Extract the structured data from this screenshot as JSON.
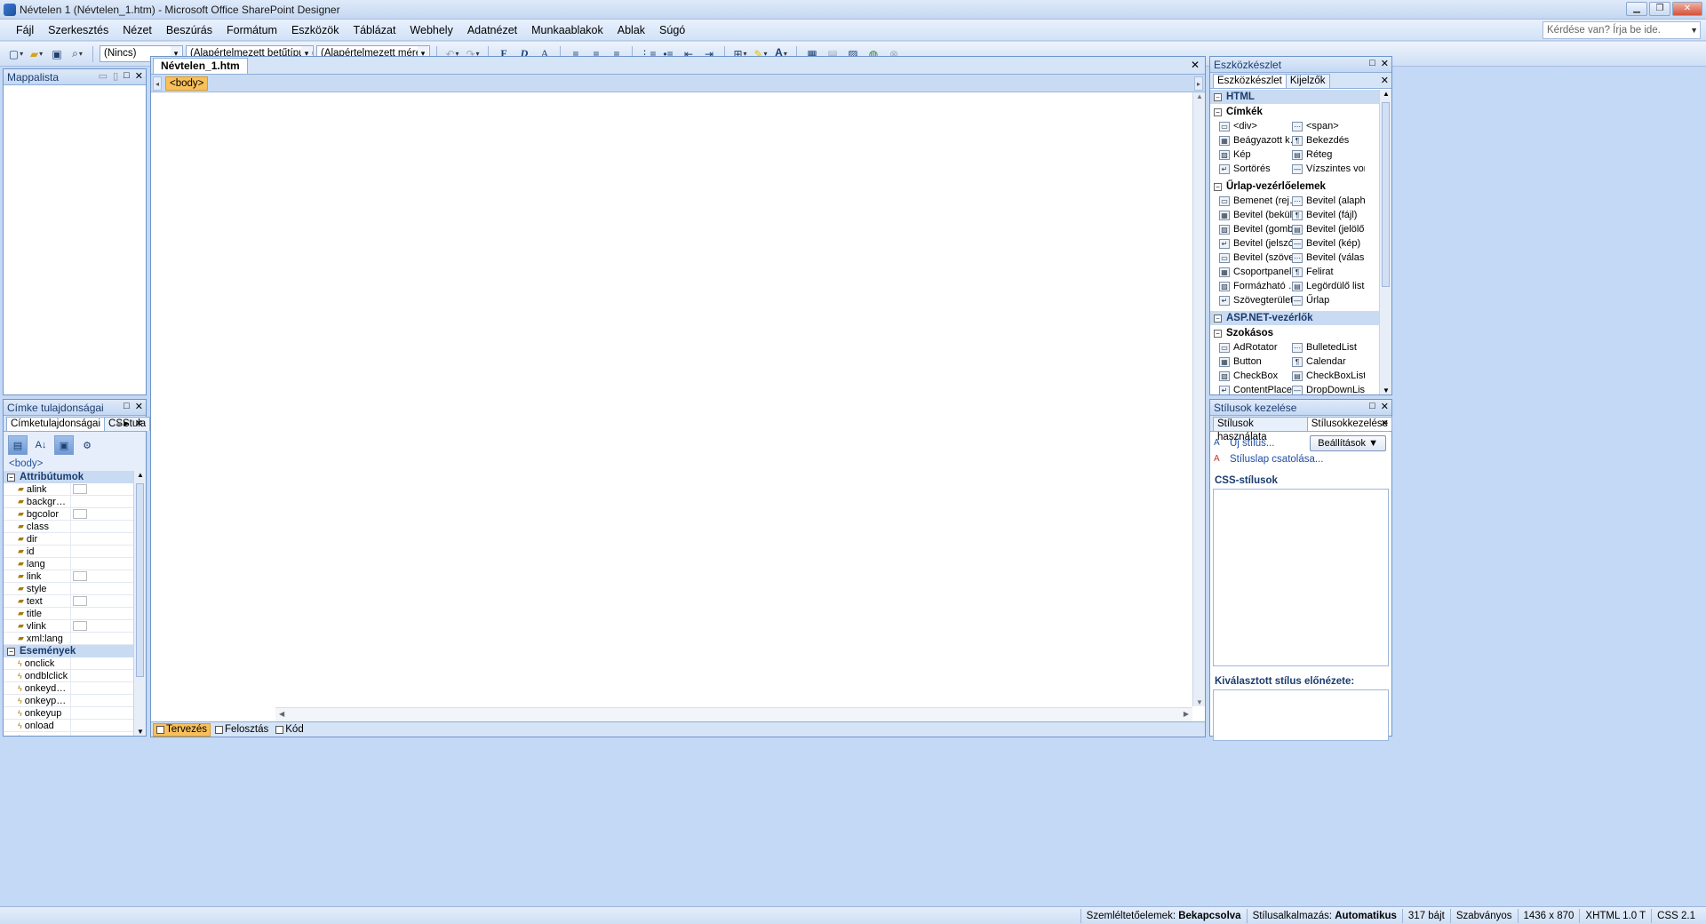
{
  "window": {
    "title": "Névtelen 1 (Névtelen_1.htm) - Microsoft Office SharePoint Designer"
  },
  "menu": {
    "items": [
      "Fájl",
      "Szerkesztés",
      "Nézet",
      "Beszúrás",
      "Formátum",
      "Eszközök",
      "Táblázat",
      "Webhely",
      "Adatnézet",
      "Munkaablakok",
      "Ablak",
      "Súgó"
    ],
    "help_placeholder": "Kérdése van? Írja be ide."
  },
  "toolbar": {
    "style_select": "(Nincs)",
    "font_select": "(Alapértelmezett betűtípus)",
    "size_select": "(Alapértelmezett mére",
    "bold": "F",
    "italic": "D",
    "underline": "A",
    "font_color": "A"
  },
  "folder_list": {
    "title": "Mappalista"
  },
  "tag_properties": {
    "title": "Címke tulajdonságai",
    "tab_tag": "Címketulajdonságai",
    "tab_css": "CSStula",
    "current_tag": "<body>",
    "categories": [
      {
        "name": "Attribútumok",
        "rows": [
          {
            "name": "alink",
            "swatch": true
          },
          {
            "name": "backgr…",
            "swatch": false
          },
          {
            "name": "bgcolor",
            "swatch": true
          },
          {
            "name": "class",
            "swatch": false
          },
          {
            "name": "dir",
            "swatch": false
          },
          {
            "name": "id",
            "swatch": false
          },
          {
            "name": "lang",
            "swatch": false
          },
          {
            "name": "link",
            "swatch": true
          },
          {
            "name": "style",
            "swatch": false
          },
          {
            "name": "text",
            "swatch": true
          },
          {
            "name": "title",
            "swatch": false
          },
          {
            "name": "vlink",
            "swatch": true
          },
          {
            "name": "xml:lang",
            "swatch": false
          }
        ]
      },
      {
        "name": "Események",
        "rows": [
          {
            "name": "onclick",
            "swatch": false
          },
          {
            "name": "ondblclick",
            "swatch": false
          },
          {
            "name": "onkeyd…",
            "swatch": false
          },
          {
            "name": "onkeyp…",
            "swatch": false
          },
          {
            "name": "onkeyup",
            "swatch": false
          },
          {
            "name": "onload",
            "swatch": false
          },
          {
            "name": "onmous…",
            "swatch": false
          }
        ]
      }
    ]
  },
  "editor": {
    "doc_tab": "Névtelen_1.htm",
    "breadcrumb_tag": "<body>",
    "view_tabs": [
      "Tervezés",
      "Felosztás",
      "Kód"
    ]
  },
  "toolbox": {
    "title": "Eszközkészlet",
    "tab_toolbox": "Eszközkészlet",
    "tab_markers": "Kijelzők",
    "sections": [
      {
        "name": "HTML",
        "groups": [
          {
            "name": "Címkék",
            "items": [
              "<div>",
              "<span>",
              "Beágyazott k…",
              "Bekezdés",
              "Kép",
              "Réteg",
              "Sortörés",
              "Vízszintes vonal"
            ]
          },
          {
            "name": "Űrlap-vezérlőelemek",
            "items": [
              "Bemenet (rej…",
              "Bevitel (alaph…",
              "Bevitel (bekül…",
              "Bevitel (fájl)",
              "Bevitel (gomb)",
              "Bevitel (jelölő…",
              "Bevitel (jelszó)",
              "Bevitel (kép)",
              "Bevitel (szöveg)",
              "Bevitel (válas…",
              "Csoportpanel",
              "Felirat",
              "Formázható …",
              "Legördülő lista",
              "Szövegterület",
              "Űrlap"
            ]
          }
        ]
      },
      {
        "name": "ASP.NET-vezérlők",
        "groups": [
          {
            "name": "Szokásos",
            "items": [
              "AdRotator",
              "BulletedList",
              "Button",
              "Calendar",
              "CheckBox",
              "CheckBoxList",
              "ContentPlace…",
              "DropDownList"
            ]
          }
        ]
      }
    ]
  },
  "styles": {
    "title": "Stílusok kezelése",
    "tab_apply": "Stílusok használata",
    "tab_manage": "Stílusokkezelése",
    "new_style": "Új stílus...",
    "attach_sheet": "Stíluslap csatolása...",
    "settings": "Beállítások",
    "css_label": "CSS-stílusok",
    "preview_label": "Kiválasztott stílus előnézete:"
  },
  "status": {
    "visual_aids_label": "Szemléltetőelemek:",
    "visual_aids_value": "Bekapcsolva",
    "style_app_label": "Stílusalkalmazás:",
    "style_app_value": "Automatikus",
    "size": "317 bájt",
    "mode": "Szabványos",
    "dimensions": "1436 x 870",
    "doctype": "XHTML 1.0 T",
    "css": "CSS 2.1"
  }
}
